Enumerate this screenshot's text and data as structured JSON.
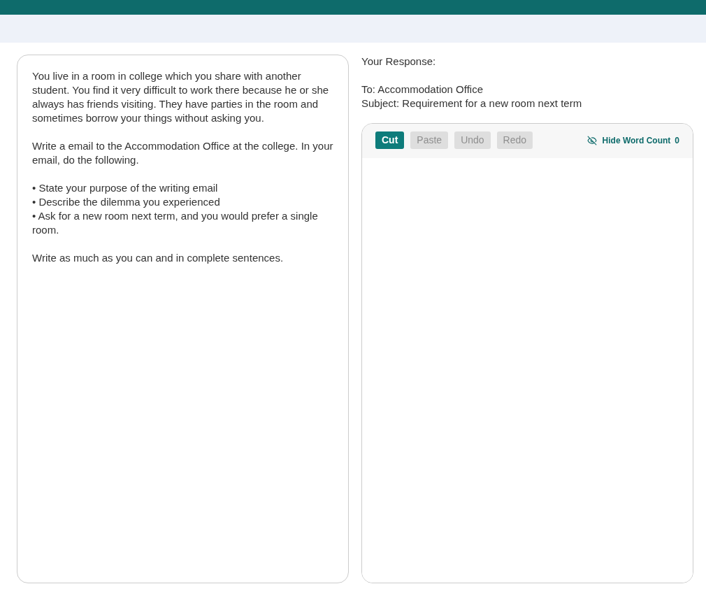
{
  "prompt": {
    "blocks": [
      {
        "kind": "paragraph",
        "text": "You live in a room in college which you share with another student. You find it very difficult to work there because he or she always has friends visiting. They have parties in the room and sometimes borrow your things without asking you."
      },
      {
        "kind": "paragraph",
        "text": "Write a email to the Accommodation Office at the college. In your email, do the following."
      },
      {
        "kind": "list",
        "items": [
          "• State your purpose of the writing email",
          "• Describe the dilemma you experienced",
          "• Ask for a new room next term, and you would prefer a single room."
        ]
      },
      {
        "kind": "paragraph",
        "text": "Write as much as you can and in complete sentences."
      }
    ]
  },
  "response": {
    "label": "Your Response:",
    "to": "To: Accommodation Office",
    "subject": "Subject: Requirement for a new room next term"
  },
  "editor": {
    "buttons": [
      {
        "label": "Cut",
        "disabled": false
      },
      {
        "label": "Paste",
        "disabled": true
      },
      {
        "label": "Undo",
        "disabled": true
      },
      {
        "label": "Redo",
        "disabled": true
      }
    ],
    "word_count": {
      "label": "Hide Word Count",
      "count": "0"
    }
  }
}
